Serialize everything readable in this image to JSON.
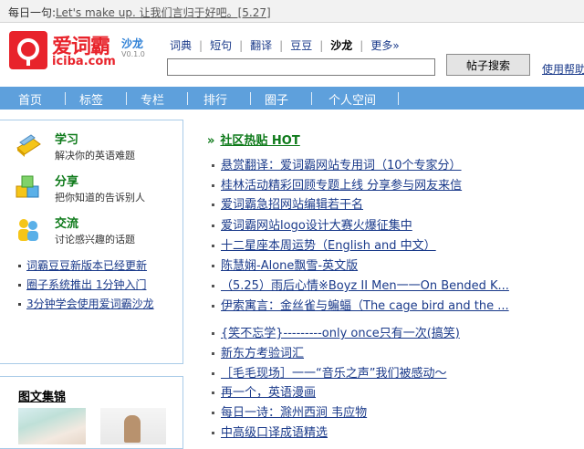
{
  "topbar": {
    "prefix": "每日一句:",
    "quote": "Let's make up. 让我们言归于好吧。[5.27]"
  },
  "logo": {
    "name": "爱词霸",
    "sub": "沙龙",
    "version": "V0.1.0",
    "domain": "iciba.com",
    "brand_color": "#e8232b"
  },
  "nav_links": [
    {
      "label": "词典"
    },
    {
      "label": "短句"
    },
    {
      "label": "翻译"
    },
    {
      "label": "豆豆"
    },
    {
      "label": "沙龙"
    },
    {
      "label": "更多»"
    }
  ],
  "search": {
    "value": "",
    "button_label": "帖子搜索",
    "help_label": "使用帮助"
  },
  "main_nav": [
    {
      "label": "首页"
    },
    {
      "label": "标签"
    },
    {
      "label": "专栏"
    },
    {
      "label": "排行"
    },
    {
      "label": "圈子"
    },
    {
      "label": "个人空间"
    }
  ],
  "sidebar": {
    "categories": [
      {
        "title": "学习",
        "desc": "解决你的英语难题",
        "icon": "pencil-book-icon"
      },
      {
        "title": "分享",
        "desc": "把你知道的告诉别人",
        "icon": "cubes-icon"
      },
      {
        "title": "交流",
        "desc": "讨论感兴趣的话题",
        "icon": "people-icon"
      }
    ],
    "links": [
      {
        "label": "词霸豆豆新版本已经更新"
      },
      {
        "label": "圈子系统推出 1分钟入门"
      },
      {
        "label": "3分钟学会使用爱词霸沙龙"
      }
    ],
    "gallery_title": "图文集锦"
  },
  "hot": {
    "arrow": "»",
    "title": "社区热贴 HOT",
    "posts": [
      {
        "label": "悬赏翻译：爱词霸网站专用词（10个专家分）"
      },
      {
        "label": "桂林活动精彩回顾专题上线 分享参与网友来信"
      },
      {
        "label": "爱词霸急招网站编辑若干名"
      },
      {
        "label": "爱词霸网站logo设计大赛火爆征集中"
      },
      {
        "label": "十二星座本周运势（English and 中文）"
      },
      {
        "label": "陈慧娴-Alone飘雪-英文版"
      },
      {
        "label": "（5.25）雨后心情※Boyz II Men一一On Bended K..."
      },
      {
        "label": "伊索寓言：金丝雀与蝙蝠（The cage bird and the ..."
      },
      {
        "label": "{笑不忘学}---------only once只有一次(搞笑)"
      },
      {
        "label": "新东方考验词汇"
      },
      {
        "label": "［毛毛现场］一一“音乐之声”我们被感动～"
      },
      {
        "label": "再一个，英语漫画"
      },
      {
        "label": "每日一诗：滁州西涧 韦应物"
      },
      {
        "label": "中高级口译成语精选"
      }
    ]
  },
  "colors": {
    "nav_bar": "#5ea0dc",
    "accent_green": "#0e7a1a",
    "link_blue": "#1a3a8a"
  }
}
